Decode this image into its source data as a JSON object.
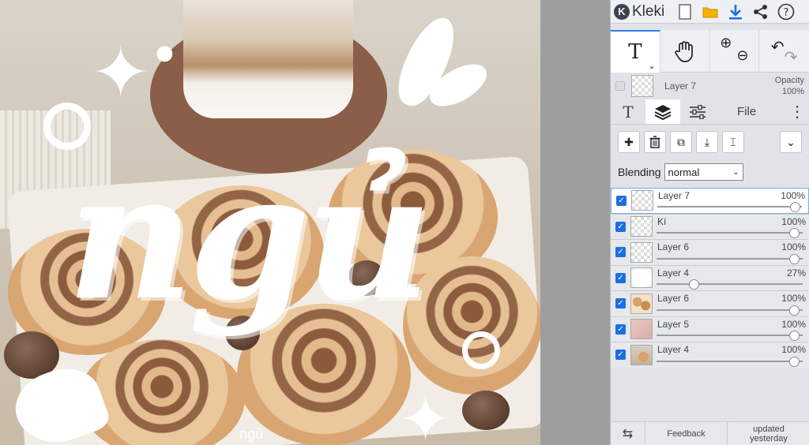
{
  "app": {
    "name": "Kleki",
    "icons": [
      "new-image-icon",
      "open-folder-icon",
      "download-icon",
      "share-icon",
      "help-icon"
    ]
  },
  "artwork": {
    "main_word": "ngủ",
    "small_caption": "ngủ"
  },
  "toolbar": {
    "text_tool": "T",
    "text_tool_sub": "⌄",
    "hand_tool_icon": "hand-icon",
    "zoom_in": "⊕",
    "zoom_out": "⊖",
    "undo": "↶",
    "redo": "↷"
  },
  "current_layer": {
    "name": "Layer 7",
    "opacity_label": "Opacity",
    "opacity_value": "100%"
  },
  "tabs": {
    "text_icon": "T",
    "layers_icon": "layers-icon",
    "adjust_icon": "sliders-icon",
    "file_label": "File",
    "more_icon": "⋮"
  },
  "layer_actions": {
    "add": "✚",
    "delete": "🗑",
    "duplicate": "⧉",
    "merge": "⤓",
    "rename": "⌶",
    "collapse": "⌄"
  },
  "blending": {
    "label": "Blending",
    "value": "normal"
  },
  "layers": [
    {
      "name": "Layer 7",
      "opacity": "100%",
      "level": 1.0,
      "thumb": "transparent",
      "selected": true
    },
    {
      "name": "Kí",
      "opacity": "100%",
      "level": 1.0,
      "thumb": "transparent",
      "selected": false
    },
    {
      "name": "Layer 6",
      "opacity": "100%",
      "level": 1.0,
      "thumb": "transparent",
      "selected": false
    },
    {
      "name": "Layer 4",
      "opacity": "27%",
      "level": 0.27,
      "thumb": "white",
      "selected": false
    },
    {
      "name": "Layer 6",
      "opacity": "100%",
      "level": 1.0,
      "thumb": "buns",
      "selected": false
    },
    {
      "name": "Layer 5",
      "opacity": "100%",
      "level": 1.0,
      "thumb": "pink",
      "selected": false
    },
    {
      "name": "Layer 4",
      "opacity": "100%",
      "level": 1.0,
      "thumb": "photo",
      "selected": false
    }
  ],
  "footer": {
    "swap_icon": "⇆",
    "feedback": "Feedback",
    "updated_line1": "updated",
    "updated_line2": "yesterday"
  },
  "colors": {
    "accent": "#1d6fe0",
    "panel_bg": "#e1e3e8",
    "canvas_bg": "#9e9e9e"
  }
}
